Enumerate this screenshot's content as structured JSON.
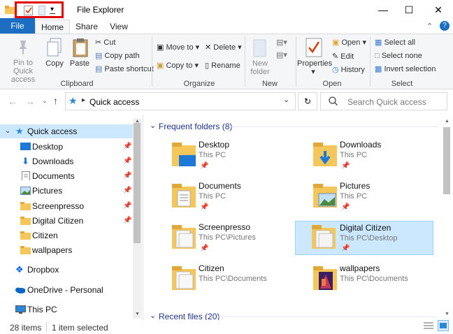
{
  "window": {
    "title": "File Explorer"
  },
  "tabs": {
    "file": "File",
    "home": "Home",
    "share": "Share",
    "view": "View"
  },
  "ribbon": {
    "clipboard": {
      "pin": "Pin to Quick\naccess",
      "copy": "Copy",
      "paste": "Paste",
      "cut": "Cut",
      "copy_path": "Copy path",
      "paste_shortcut": "Paste shortcut",
      "label": "Clipboard"
    },
    "organize": {
      "move_to": "Move to",
      "copy_to": "Copy to",
      "delete": "Delete",
      "rename": "Rename",
      "label": "Organize"
    },
    "new": {
      "new_folder": "New\nfolder",
      "label": "New"
    },
    "open": {
      "properties": "Properties",
      "open": "Open",
      "edit": "Edit",
      "history": "History",
      "label": "Open"
    },
    "select": {
      "select_all": "Select all",
      "select_none": "Select none",
      "invert": "Invert selection",
      "label": "Select"
    }
  },
  "address": {
    "path": "Quick access",
    "search_placeholder": "Search Quick access"
  },
  "nav": {
    "quick_access": "Quick access",
    "items": [
      {
        "label": "Desktop",
        "pinned": true
      },
      {
        "label": "Downloads",
        "pinned": true
      },
      {
        "label": "Documents",
        "pinned": true
      },
      {
        "label": "Pictures",
        "pinned": true
      },
      {
        "label": "Screenpresso",
        "pinned": true
      },
      {
        "label": "Digital Citizen",
        "pinned": true
      },
      {
        "label": "Citizen",
        "pinned": false
      },
      {
        "label": "wallpapers",
        "pinned": false
      }
    ],
    "dropbox": "Dropbox",
    "onedrive": "OneDrive - Personal",
    "thispc": "This PC"
  },
  "content": {
    "frequent_header": "Frequent folders (8)",
    "recent_header": "Recent files (20)",
    "folders": [
      {
        "name": "Desktop",
        "path": "This PC",
        "pinned": true
      },
      {
        "name": "Downloads",
        "path": "This PC",
        "pinned": true
      },
      {
        "name": "Documents",
        "path": "This PC",
        "pinned": true
      },
      {
        "name": "Pictures",
        "path": "This PC",
        "pinned": true
      },
      {
        "name": "Screenpresso",
        "path": "This PC\\Pictures",
        "pinned": true
      },
      {
        "name": "Digital Citizen",
        "path": "This PC\\Desktop",
        "pinned": true,
        "selected": true
      },
      {
        "name": "Citizen",
        "path": "This PC\\Documents",
        "pinned": false
      },
      {
        "name": "wallpapers",
        "path": "This PC\\Documents",
        "pinned": false
      }
    ]
  },
  "status": {
    "items": "28 items",
    "selected": "1 item selected"
  },
  "colors": {
    "accent": "#1b6ec2",
    "selection": "#cce8ff",
    "highlight_box": "#e00000",
    "folder": "#f5c65a"
  }
}
